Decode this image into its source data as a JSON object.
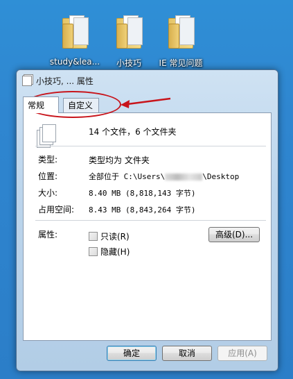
{
  "desktop": {
    "icons": [
      {
        "label": "study&lea...",
        "icon": "folder-icon"
      },
      {
        "label": "小技巧",
        "icon": "folder-icon"
      },
      {
        "label": "IE 常见问题",
        "icon": "folder-icon"
      }
    ]
  },
  "window": {
    "title": "小技巧, ... 属性",
    "tabs": [
      "常规",
      "自定义"
    ],
    "summary": "14 个文件，6 个文件夹",
    "properties": {
      "type_label": "类型:",
      "type_value": "类型均为 文件夹",
      "location_label": "位置:",
      "location_prefix": "全部位于 C:\\Users\\",
      "location_suffix": "\\Desktop",
      "size_label": "大小:",
      "size_value": "8.40 MB (8,818,143 字节)",
      "disk_label": "占用空间:",
      "disk_value": "8.43 MB (8,843,264 字节)"
    },
    "attributes": {
      "label": "属性:",
      "readonly": "只读(R)",
      "readonly_checked": false,
      "hidden": "隐藏(H)",
      "hidden_checked": false,
      "advanced": "高级(D)..."
    },
    "buttons": {
      "ok": "确定",
      "cancel": "取消",
      "apply": "应用(A)"
    }
  },
  "colors": {
    "desktop": "#2f86d0",
    "annotation": "#c8141b"
  }
}
